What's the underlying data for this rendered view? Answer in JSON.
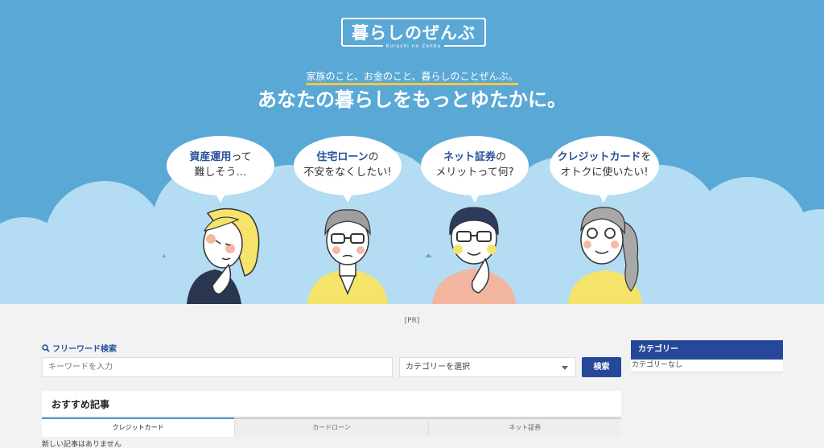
{
  "hero": {
    "logo_text": "暮らしのぜんぶ",
    "logo_sub": "Kurashi no Zenbu",
    "tagline_small": "家族のこと、お金のこと、暮らしのことぜんぶ。",
    "tagline_big": "あなたの暮らしをもっとゆたかに。",
    "bubbles": [
      {
        "em": "資産運用",
        "rest": "って",
        "line2": "難しそう…"
      },
      {
        "em": "住宅ローン",
        "rest": "の",
        "line2": "不安をなくしたい!"
      },
      {
        "em": "ネット証券",
        "rest": "の",
        "line2": "メリットって何?"
      },
      {
        "em": "クレジットカード",
        "rest": "を",
        "line2": "オトクに使いたい!"
      }
    ],
    "colors": {
      "sky": "#5aa8d6",
      "cloud": "#b4dcf3",
      "accent": "#f5c93b",
      "brand": "#27519a"
    }
  },
  "pr_label": "[PR]",
  "search": {
    "label": "フリーワード検索",
    "placeholder": "キーワードを入力",
    "category_select": "カテゴリーを選択",
    "button": "検索"
  },
  "sidebar": {
    "heading": "カテゴリー",
    "empty": "カテゴリーなし"
  },
  "recommended": {
    "title": "おすすめ記事",
    "tabs": [
      "クレジットカード",
      "カードローン",
      "ネット証券"
    ],
    "empty": "新しい記事はありません"
  }
}
